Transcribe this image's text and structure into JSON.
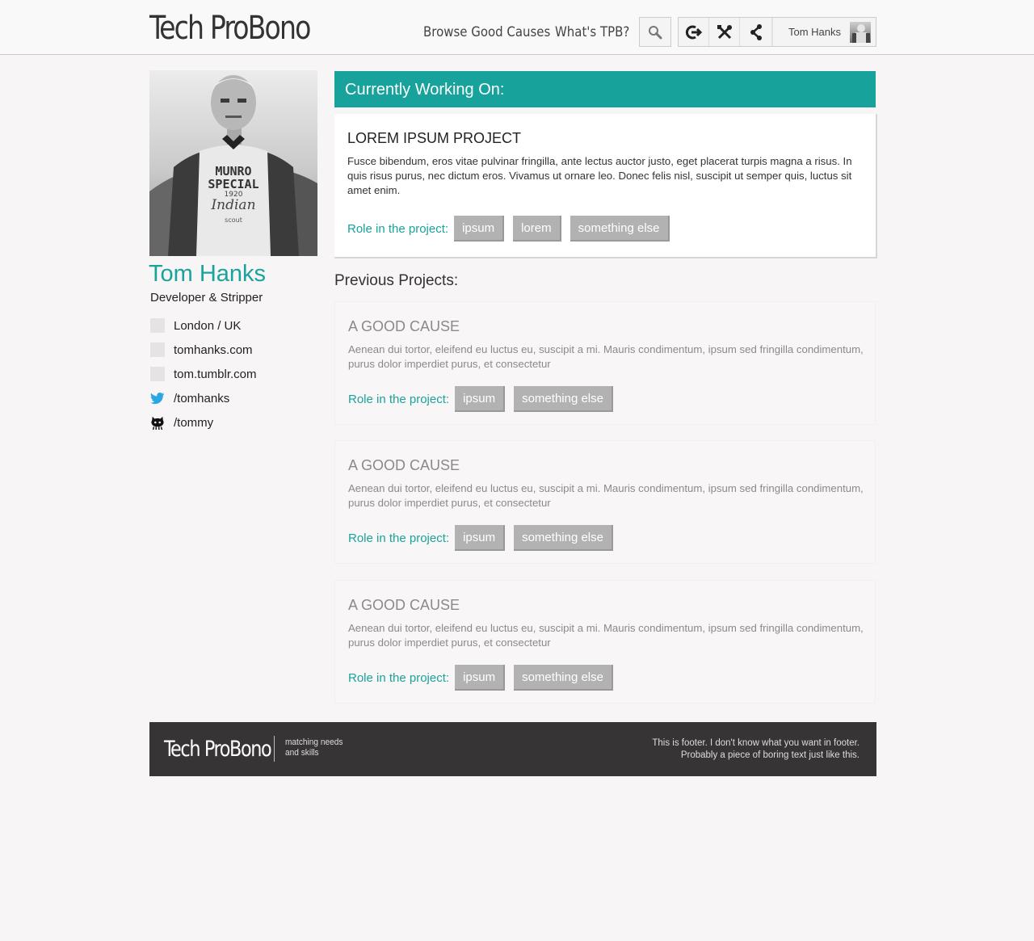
{
  "header": {
    "logo": "Tech ProBono",
    "nav": {
      "browse": "Browse Good Causes",
      "what": "What's TPB?"
    },
    "user_name": "Tom Hanks"
  },
  "profile": {
    "name": "Tom Hanks",
    "title": "Developer & Stripper",
    "info": {
      "location": "London / UK",
      "website": "tomhanks.com",
      "tumblr": "tom.tumblr.com",
      "twitter": "/tomhanks",
      "github": "/tommy"
    },
    "photo_text": [
      "MUNRO",
      "SPECIAL",
      "1920",
      "Indian",
      "scout"
    ]
  },
  "current": {
    "heading": "Currently Working On:",
    "title": "LOREM IPSUM PROJECT",
    "description": "Fusce bibendum, eros vitae pulvinar fringilla, ante lectus auctor justo, eget placerat turpis magna a risus. In quis risus purus, nec dictum eros. Vivamus ut ornare leo. Donec felis nisl, suscipit ut semper quis, luctus sit amet enim.",
    "role_label": "Role in the project:",
    "tags": [
      "ipsum",
      "lorem",
      "something else"
    ]
  },
  "previous": {
    "heading": "Previous Projects:",
    "projects": [
      {
        "title": "A GOOD CAUSE",
        "description": "Aenean dui tortor, eleifend eu luctus eu, suscipit a mi. Mauris condimentum, ipsum sed fringilla condimentum, purus dolor imperdiet purus, et consectetur",
        "role_label": "Role in the project:",
        "tags": [
          "ipsum",
          "something else"
        ]
      },
      {
        "title": "A GOOD CAUSE",
        "description": "Aenean dui tortor, eleifend eu luctus eu, suscipit a mi. Mauris condimentum, ipsum sed fringilla condimentum, purus dolor imperdiet purus, et consectetur",
        "role_label": "Role in the project:",
        "tags": [
          "ipsum",
          "something else"
        ]
      },
      {
        "title": "A GOOD CAUSE",
        "description": "Aenean dui tortor, eleifend eu luctus eu, suscipit a mi. Mauris condimentum, ipsum sed fringilla condimentum, purus dolor imperdiet purus, et consectetur",
        "role_label": "Role in the project:",
        "tags": [
          "ipsum",
          "something else"
        ]
      }
    ]
  },
  "footer": {
    "logo": "Tech ProBono",
    "tagline_1": "matching needs",
    "tagline_2": "and skills",
    "text_1": "This is footer. I don't know what you want in footer.",
    "text_2": "Probably a piece of boring text just like this."
  },
  "colors": {
    "accent": "#17a29b",
    "tag": "#b2b2b2",
    "footer": "#363435",
    "background": "#f7f5f6"
  },
  "icons": [
    "search-icon",
    "logout-icon",
    "tools-icon",
    "share-icon",
    "twitter-icon",
    "github-icon"
  ]
}
